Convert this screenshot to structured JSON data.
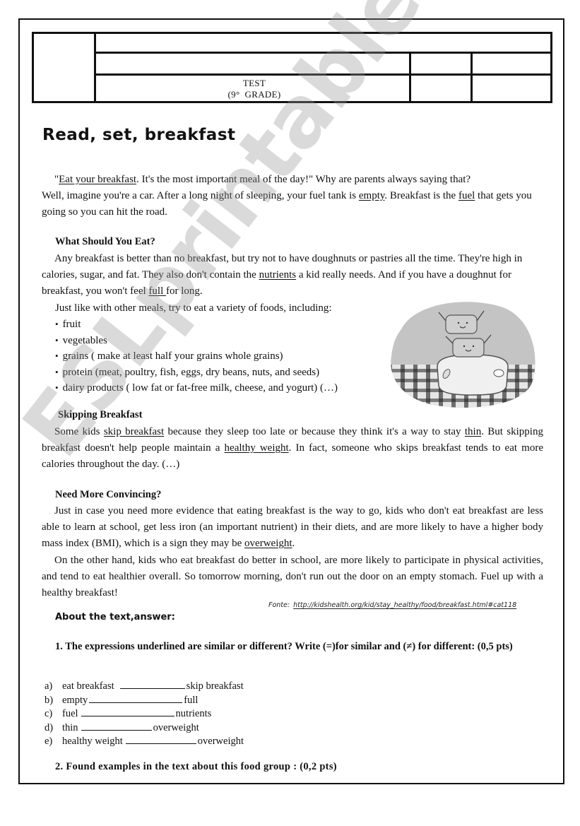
{
  "header": {
    "test_label": "TEST",
    "grade_label": "(9°  GRADE)"
  },
  "title": "Read, set, breakfast",
  "intro": {
    "p1_quote_open": "\"",
    "p1_underlined": "Eat your breakfast",
    "p1_rest": ". It's the most important meal of the day!\" Why are parents always saying that?",
    "p2_a": "Well, imagine you're a car. After a long night of sleeping, your fuel tank is ",
    "p2_u1": "empty",
    "p2_b": ". Breakfast is the ",
    "p2_u2": "fuel",
    "p2_c": " that gets you going so you can hit the road."
  },
  "section_eat": {
    "heading": "What Should You Eat?",
    "p_a": "Any breakfast is better than no breakfast, but try not to have doughnuts or pastries all the time. They're high in calories, sugar, and fat. They also don't contain the ",
    "p_u1": "nutrients",
    "p_b": " a kid really needs. And if you have a doughnut for breakfast, you won't feel ",
    "p_u2": "full ",
    "p_c": "for long.",
    "list_intro": "Just like with other meals, try to eat a variety of foods, including:",
    "items": [
      "fruit",
      "vegetables",
      "grains ( make at least half your grains whole grains)",
      "protein (meat, poultry, fish, eggs, dry beans, nuts, and seeds)",
      "dairy products ( low fat or fat-free milk, cheese, and yogurt) (…)"
    ]
  },
  "section_skip": {
    "heading": "Skipping Breakfast",
    "p_a": "Some kids ",
    "p_u1": "skip breakfast",
    "p_b": " because they sleep too late or because they think it's a way to stay ",
    "p_u2": "thin",
    "p_c": ". But skipping breakfast doesn't help people maintain a ",
    "p_u3": "healthy weight",
    "p_d": ". In fact, someone who skips breakfast tends to eat more calories throughout the day. (…)"
  },
  "section_convince": {
    "heading": "Need More Convincing?",
    "p1_a": "Just in case you need more evidence that eating breakfast is the way to go, kids who don't eat breakfast are less able to learn at school, get less iron (an important nutrient) in their diets, and are more likely to have a higher body mass index (BMI), which is a sign they may be ",
    "p1_u": "overweight",
    "p1_b": ".",
    "p2": "On the other hand, kids who eat breakfast do better in school, are more likely to participate in physical activities, and tend to eat healthier overall. So tomorrow morning, don't run out the door on an empty stomach. Fuel up with a healthy breakfast!"
  },
  "source": {
    "label": "Fonte:",
    "link": "http://kidshealth.org/kid/stay_healthy/food/breakfast.html#cat118"
  },
  "about_label": "About the text,answer:",
  "question1": {
    "text": "1. The expressions underlined are similar or different? Write (=)for similar and (≠)  for different: (0,5 pts)",
    "pairs": [
      {
        "letter": "a)",
        "left": "eat breakfast",
        "right": "skip breakfast"
      },
      {
        "letter": "b)",
        "left": "empty",
        "right": "full"
      },
      {
        "letter": "c)",
        "left": "fuel",
        "right": "nutrients"
      },
      {
        "letter": "d)",
        "left": "thin",
        "right": "overweight"
      },
      {
        "letter": "e)",
        "left": "healthy weight",
        "right": "overweight"
      }
    ]
  },
  "question2": {
    "text": "2.  Found examples in the text about this food group : (0,2 pts)"
  },
  "watermark": "ESLprintables.com",
  "illustration": "toaster-with-toast-icon"
}
